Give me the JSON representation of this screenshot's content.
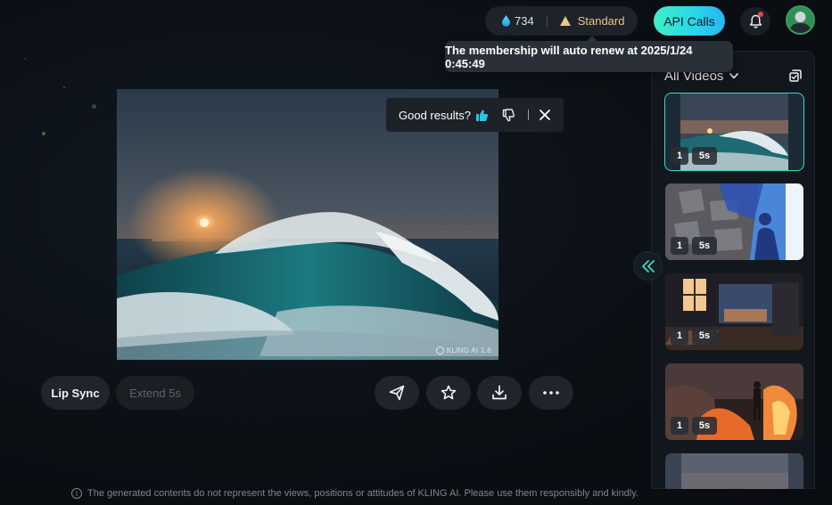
{
  "topbar": {
    "credits": "734",
    "plan": "Standard",
    "api_button": "API Calls",
    "icons": [
      "drop-icon",
      "triangle-icon",
      "bell-icon",
      "avatar"
    ]
  },
  "tooltip": {
    "text": "The membership will auto renew at 2025/1/24 0:45:49"
  },
  "feedback": {
    "label": "Good results?",
    "icons": [
      "thumbs-up-icon",
      "thumbs-down-icon",
      "close-icon"
    ]
  },
  "video": {
    "watermark": "KLING AI 1.6"
  },
  "actions": {
    "lip_sync": "Lip Sync",
    "extend": "Extend 5s",
    "icons": [
      "share-icon",
      "star-icon",
      "download-icon",
      "more-icon"
    ]
  },
  "side_panel": {
    "title": "All Videos",
    "items": [
      {
        "count": "1",
        "duration": "5s",
        "selected": true
      },
      {
        "count": "1",
        "duration": "5s",
        "selected": false
      },
      {
        "count": "1",
        "duration": "5s",
        "selected": false
      },
      {
        "count": "1",
        "duration": "5s",
        "selected": false
      }
    ]
  },
  "footer": {
    "disclaimer": "The generated contents do not represent the views, positions or attitudes of KLING AI. Please use them responsibly and kindly."
  },
  "colors": {
    "accent": "#3fd8c2",
    "plan": "#e8c58a",
    "background": "#0b0f14"
  }
}
